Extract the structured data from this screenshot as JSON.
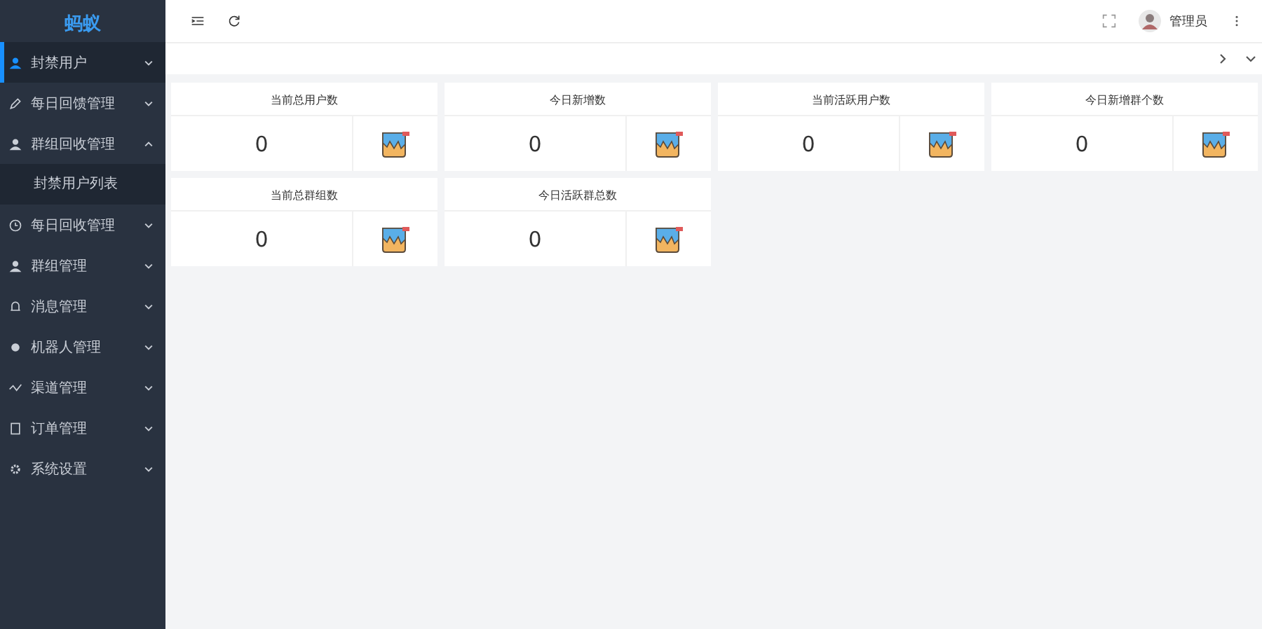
{
  "sidebar": {
    "logo": "蚂蚁",
    "items": [
      {
        "label": "封禁用户",
        "selected": true,
        "expanded": false
      },
      {
        "label": "每日回馈管理",
        "selected": false,
        "expanded": false
      },
      {
        "label": "群组回收管理",
        "selected": false,
        "expanded": true,
        "children": [
          {
            "label": "封禁用户列表",
            "selected": false
          }
        ]
      },
      {
        "label": "每日回收管理",
        "selected": false,
        "expanded": false
      },
      {
        "label": "群组管理",
        "selected": false,
        "expanded": false
      },
      {
        "label": "消息管理",
        "selected": false,
        "expanded": false
      },
      {
        "label": "机器人管理",
        "selected": false,
        "expanded": false
      },
      {
        "label": "渠道管理",
        "selected": false,
        "expanded": false
      },
      {
        "label": "订单管理",
        "selected": false,
        "expanded": false
      },
      {
        "label": "系统设置",
        "selected": false,
        "expanded": false
      }
    ]
  },
  "header": {
    "user": "管理员"
  },
  "cards": [
    {
      "title": "当前总用户数",
      "value": "0"
    },
    {
      "title": "今日新增数",
      "value": "0"
    },
    {
      "title": "当前活跃用户数",
      "value": "0"
    },
    {
      "title": "今日新增群个数",
      "value": "0"
    },
    {
      "title": "当前总群组数",
      "value": "0"
    },
    {
      "title": "今日活跃群总数",
      "value": "0"
    }
  ]
}
